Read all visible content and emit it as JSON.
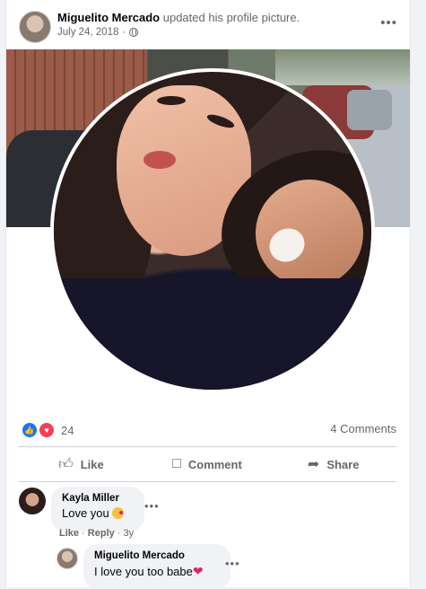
{
  "post": {
    "author": "Miguelito Mercado",
    "action": " updated his profile picture.",
    "date": "July 24, 2018",
    "meta_separator": " · ",
    "more_icon": "more-horizontal-icon",
    "privacy_icon": "globe-icon"
  },
  "stats": {
    "reaction_count": "24",
    "comments_label": "4 Comments"
  },
  "actions": {
    "like": "Like",
    "comment": "Comment",
    "share": "Share"
  },
  "comments": [
    {
      "author": "Kayla Miller",
      "text": "Love you ",
      "emoji": "kissing-face-emoji",
      "meta": {
        "like": "Like",
        "reply": "Reply",
        "time": "3y"
      }
    },
    {
      "author": "Miguelito Mercado",
      "text": "I love you too babe",
      "emoji": "heart-emoji"
    }
  ],
  "colors": {
    "like_blue": "#1877f2",
    "love_red": "#f33e58",
    "secondary_text": "#65676b"
  }
}
